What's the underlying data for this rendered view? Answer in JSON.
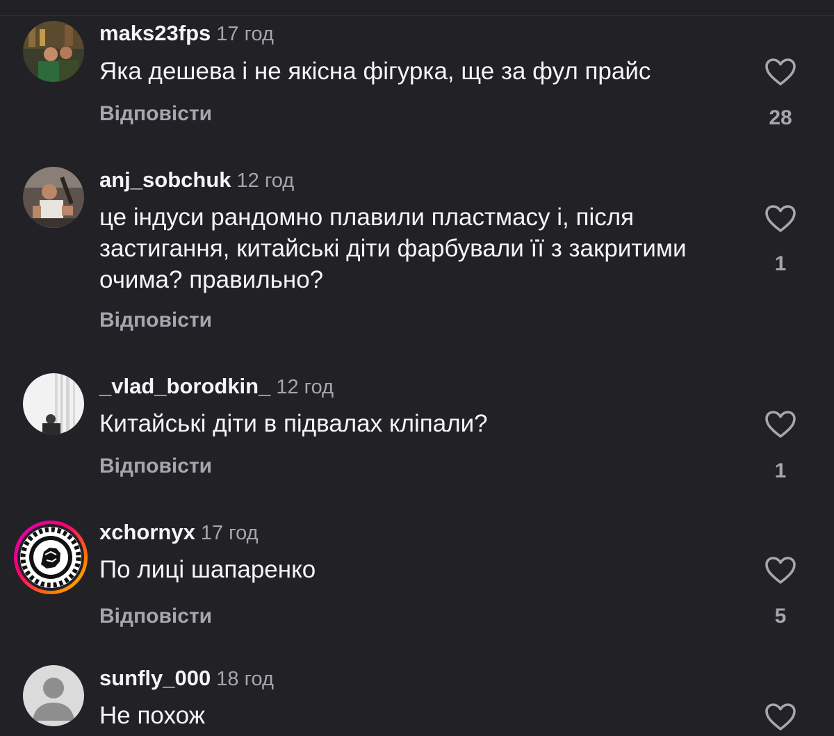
{
  "reply_label": "Відповісти",
  "colors": {
    "background": "#212126",
    "text": "#f5f5f5",
    "muted": "#a6a6ad",
    "story_ring": [
      "#d300c5",
      "#ff0069",
      "#ff7a00",
      "#ffd600"
    ]
  },
  "comments": [
    {
      "username": "maks23fps",
      "time": "17 год",
      "text": "Яка дешева і не якісна фігурка, ще за фул прайс",
      "likes": "28",
      "avatar": "photo-avatar"
    },
    {
      "username": "anj_sobchuk",
      "time": "12 год",
      "text": "це індуси рандомно плавили пластмасу і, після застигання, китайські діти фарбували її з закритими очима? правильно?",
      "likes": "1",
      "avatar": "photo-avatar"
    },
    {
      "username": "_vlad_borodkin_",
      "time": "12 год",
      "text": "Китайські діти в підвалах кліпали?",
      "likes": "1",
      "avatar": "photo-avatar"
    },
    {
      "username": "xchornyx",
      "time": "17 год",
      "text": "По лиці шапаренко",
      "likes": "5",
      "avatar": "story-ring-avatar"
    },
    {
      "username": "sunfly_000",
      "time": "18 год",
      "text": "Не похож",
      "likes": "",
      "avatar": "default-avatar"
    }
  ],
  "icons": {
    "like": "heart-outline-icon",
    "default_avatar": "person-silhouette-icon"
  }
}
